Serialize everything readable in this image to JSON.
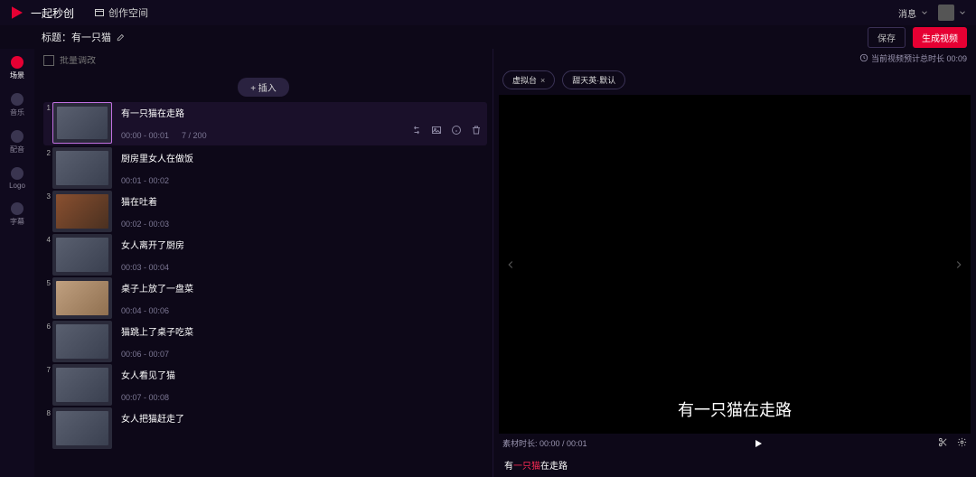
{
  "topbar": {
    "brand": "一起秒创",
    "workspace": "创作空间",
    "message": "消息"
  },
  "header": {
    "title_label": "标题：有一只猫",
    "btn_save": "保存",
    "btn_generate": "生成视频"
  },
  "rail": [
    {
      "label": "场景",
      "active": true
    },
    {
      "label": "音乐",
      "active": false
    },
    {
      "label": "配音",
      "active": false
    },
    {
      "label": "Logo",
      "active": false
    },
    {
      "label": "字幕",
      "active": false
    }
  ],
  "left": {
    "search_placeholder": "批量调改",
    "insert_label": "+ 插入"
  },
  "scenes": [
    {
      "n": "1",
      "text": "有一只猫在走路",
      "time": "00:00 - 00:01",
      "count": "7 / 200",
      "selected": true
    },
    {
      "n": "2",
      "text": "厨房里女人在做饭",
      "time": "00:01 - 00:02"
    },
    {
      "n": "3",
      "text": "猫在吐着",
      "time": "00:02 - 00:03"
    },
    {
      "n": "4",
      "text": "女人离开了厨房",
      "time": "00:03 - 00:04"
    },
    {
      "n": "5",
      "text": "桌子上放了一盘菜",
      "time": "00:04 - 00:06"
    },
    {
      "n": "6",
      "text": "猫跳上了桌子吃菜",
      "time": "00:06 - 00:07"
    },
    {
      "n": "7",
      "text": "女人看见了猫",
      "time": "00:07 - 00:08"
    },
    {
      "n": "8",
      "text": "女人把猫赶走了",
      "time": ""
    }
  ],
  "right": {
    "info": "当前视频预计总时长 00:09",
    "chips": [
      {
        "label": "虚拟台",
        "closable": true
      },
      {
        "label": "甜天英·默认",
        "closable": false
      }
    ],
    "caption": "有一只猫在走路",
    "timer_label": "素材时长: 00:00 / 00:01",
    "subtitle_pre": "有",
    "subtitle_hl": "一只猫",
    "subtitle_post": "在走路"
  }
}
